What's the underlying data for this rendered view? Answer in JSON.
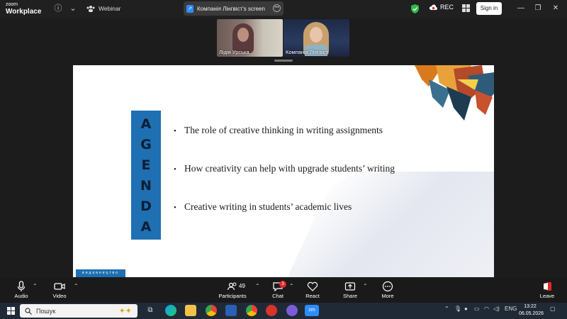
{
  "app": {
    "logo_line1": "zoom",
    "logo_line2": "Workplace",
    "webinar_label": "Webinar"
  },
  "screen_tab": {
    "title": "Компанія Лінгвіст's screen"
  },
  "titlebar": {
    "rec_label": "REC",
    "signin_label": "Sign in"
  },
  "participants_video": [
    {
      "name": "Лідія Урська"
    },
    {
      "name": "Компанія Лінгвіст"
    }
  ],
  "slide": {
    "agenda_letters": [
      "A",
      "G",
      "E",
      "N",
      "D",
      "A"
    ],
    "bullets": [
      "The role of creative thinking in writing assignments",
      "How creativity can help with upgrade students’ writing",
      "Creative writing in students’ academic lives"
    ],
    "footer_tag": "видавництво"
  },
  "toolbar": {
    "audio": "Audio",
    "video": "Video",
    "participants": "Participants",
    "participant_count": "49",
    "chat": "Chat",
    "chat_badge": "3",
    "react": "React",
    "share": "Share",
    "more": "More",
    "leave": "Leave"
  },
  "taskbar": {
    "search_placeholder": "Пошук",
    "lang": "ENG",
    "time": "13:22",
    "date": "06.05.2026"
  },
  "colors": {
    "accent": "#2d8cff",
    "agenda_blue": "#1f6fb3",
    "badge_red": "#e02828"
  }
}
